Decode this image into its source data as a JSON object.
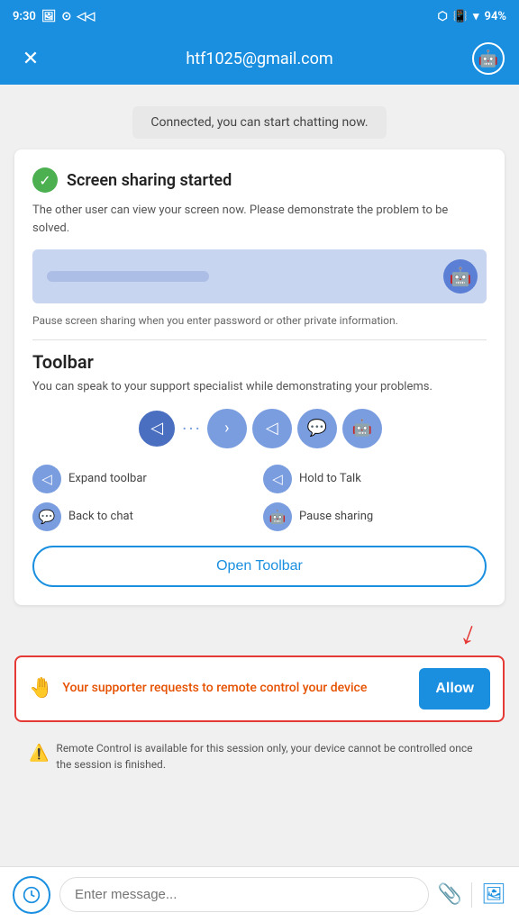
{
  "statusBar": {
    "time": "9:30",
    "battery": "94%"
  },
  "header": {
    "title": "htf1025@gmail.com",
    "closeLabel": "✕"
  },
  "connectedBanner": {
    "text": "Connected, you can start chatting now."
  },
  "screenSharing": {
    "title": "Screen sharing started",
    "description": "The other user can view your screen now. Please demonstrate the problem to be solved.",
    "pauseText": "Pause screen sharing when you enter password or other private information."
  },
  "toolbar": {
    "title": "Toolbar",
    "description": "You can speak to your support specialist while demonstrating your problems.",
    "openButtonLabel": "Open Toolbar",
    "legends": [
      {
        "label": "Expand toolbar"
      },
      {
        "label": "Hold to Talk"
      },
      {
        "label": "Back to chat"
      },
      {
        "label": "Pause sharing"
      }
    ]
  },
  "remoteControl": {
    "text": "Your supporter requests to remote control your device",
    "allowLabel": "Allow"
  },
  "infoText": "Remote Control is available for this session only, your device cannot be controlled once the session is finished.",
  "bottomBar": {
    "placeholder": "Enter message..."
  }
}
